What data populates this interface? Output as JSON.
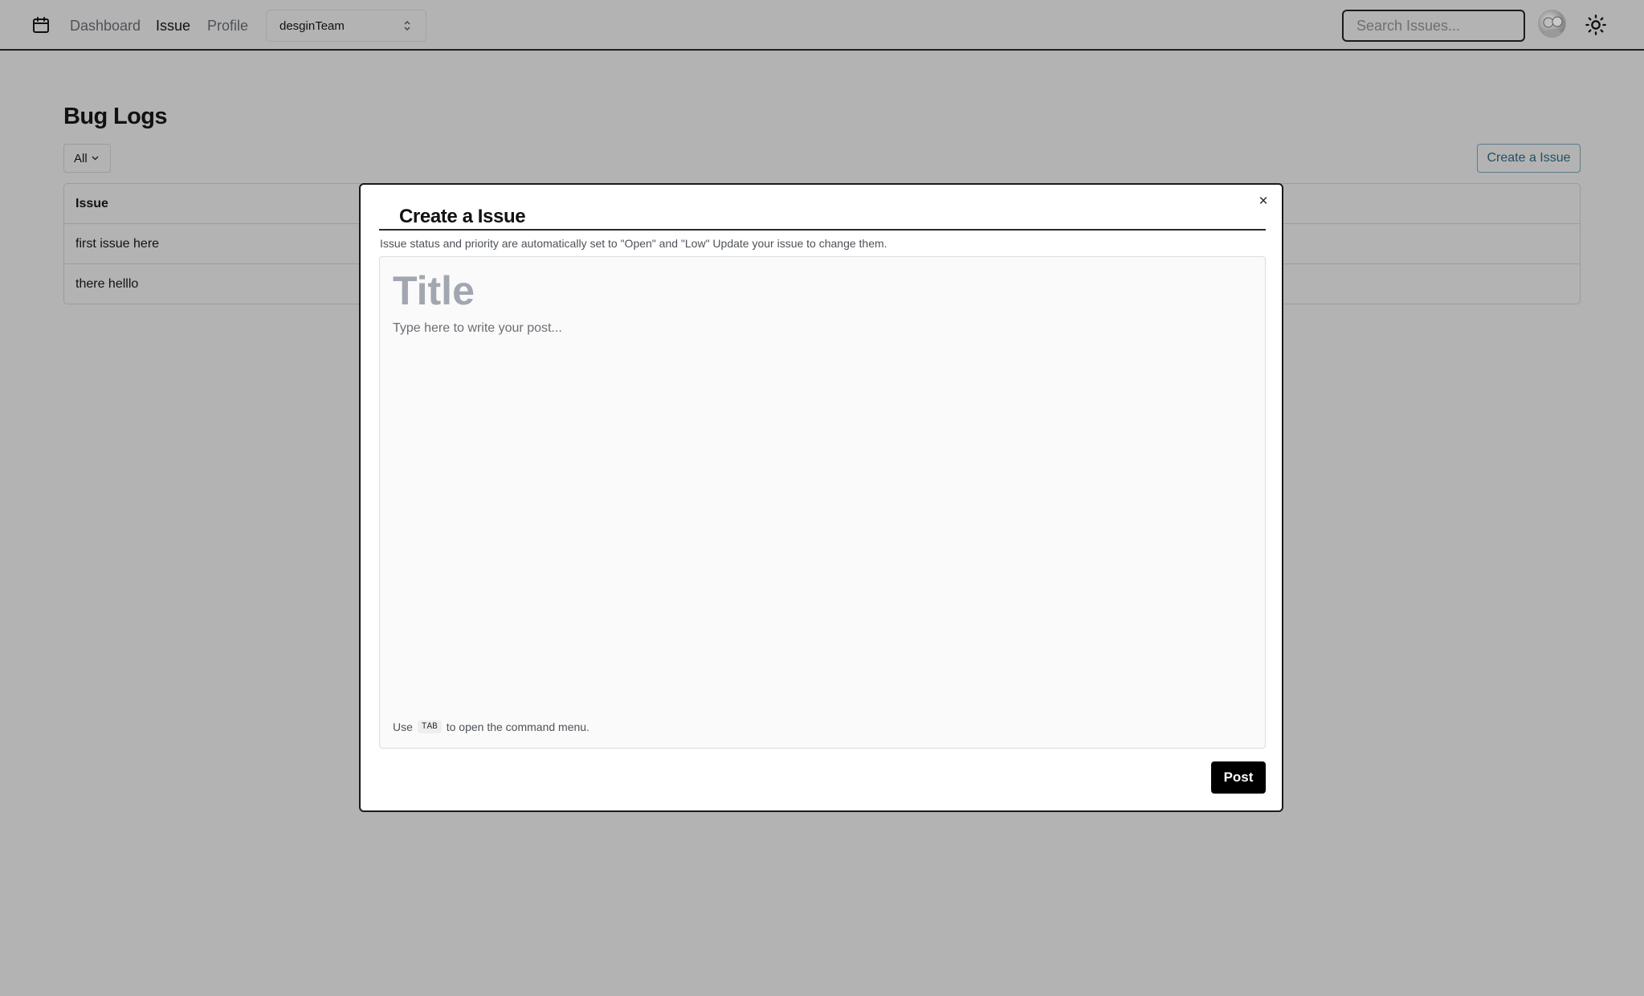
{
  "nav": {
    "dashboard": "Dashboard",
    "issue": "Issue",
    "profile": "Profile",
    "team_selected": "desginTeam",
    "search_placeholder": "Search Issues..."
  },
  "page": {
    "title": "Bug Logs",
    "filter_label": "All",
    "create_button": "Create a Issue"
  },
  "table": {
    "header": "Issue",
    "rows": [
      "first issue here",
      "there helllo"
    ]
  },
  "modal": {
    "title": "Create a Issue",
    "close": "×",
    "description": "Issue status and priority are automatically set to \"Open\" and \"Low\" Update your issue to change them.",
    "title_placeholder": "Title",
    "body_placeholder": "Type here to write your post...",
    "hint_prefix": "Use",
    "hint_key": "TAB",
    "hint_suffix": "to open the command menu.",
    "post_button": "Post"
  },
  "icons": {
    "logo": "bug-box-icon",
    "select": "chevron-up-down-icon",
    "filter": "chevron-down-icon",
    "theme": "sun-icon"
  }
}
